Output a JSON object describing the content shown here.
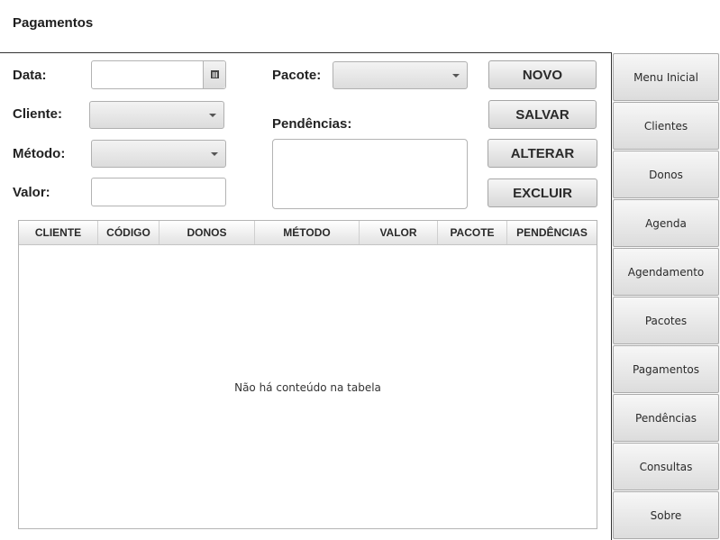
{
  "header": {
    "title": "Pagamentos"
  },
  "form": {
    "data_label": "Data:",
    "cliente_label": "Cliente:",
    "metodo_label": "Método:",
    "valor_label": "Valor:",
    "pacote_label": "Pacote:",
    "pendencias_label": "Pendências:",
    "data_value": "",
    "cliente_value": "",
    "metodo_value": "",
    "valor_value": "",
    "pacote_value": "",
    "pendencias_value": ""
  },
  "actions": {
    "novo": "NOVO",
    "salvar": "SALVAR",
    "alterar": "ALTERAR",
    "excluir": "EXCLUIR"
  },
  "table": {
    "columns": [
      "CLIENTE",
      "CÓDIGO",
      "DONOS",
      "MÉTODO",
      "VALOR",
      "PACOTE",
      "PENDÊNCIAS"
    ],
    "rows": [],
    "empty_message": "Não há conteúdo na tabela"
  },
  "sidebar": {
    "items": [
      {
        "label": "Menu Inicial"
      },
      {
        "label": "Clientes"
      },
      {
        "label": "Donos"
      },
      {
        "label": "Agenda"
      },
      {
        "label": "Agendamento"
      },
      {
        "label": "Pacotes"
      },
      {
        "label": "Pagamentos"
      },
      {
        "label": "Pendências"
      },
      {
        "label": "Consultas"
      },
      {
        "label": "Sobre"
      }
    ]
  },
  "icons": {
    "date_picker": "calendar-icon",
    "combo_arrow": "chevron-down-icon"
  }
}
